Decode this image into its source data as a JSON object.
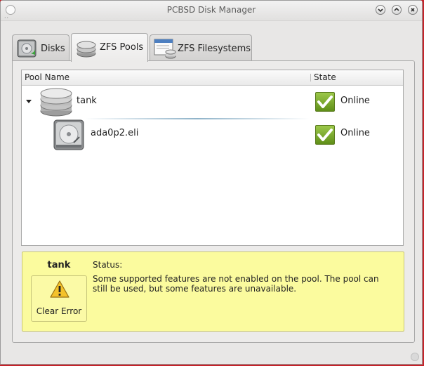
{
  "window": {
    "title": "PCBSD Disk Manager",
    "buttons": [
      "minimize",
      "maximize",
      "close"
    ]
  },
  "tabs": [
    {
      "label": "Disks",
      "icon": "harddisk-icon",
      "active": false
    },
    {
      "label": "ZFS Pools",
      "icon": "pool-icon",
      "active": true
    },
    {
      "label": "ZFS Filesystems",
      "icon": "filesystem-icon",
      "active": false
    }
  ],
  "tree": {
    "columns": [
      "Pool Name",
      "State"
    ],
    "rows": [
      {
        "name": "tank",
        "state": "Online",
        "expanded": true,
        "icon": "pool-icon"
      },
      {
        "name": "ada0p2.eli",
        "state": "Online",
        "icon": "harddisk-icon"
      }
    ]
  },
  "status": {
    "pool": "tank",
    "heading": "Status:",
    "message": "Some supported features are not enabled on the pool. The pool can still be used, but some features are unavailable.",
    "button_label": "Clear Error",
    "icon": "warning-icon"
  },
  "colors": {
    "status_background": "#fbfb9e",
    "online_check": "#6e9a22"
  }
}
